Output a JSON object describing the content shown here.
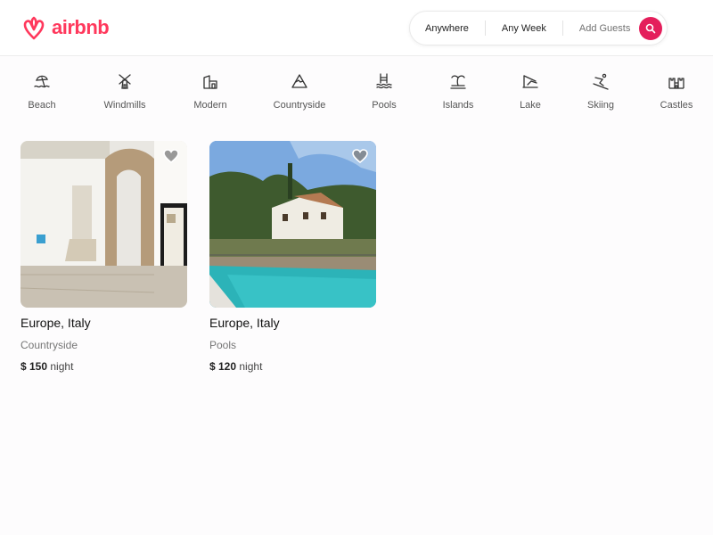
{
  "brand": {
    "name": "airbnb",
    "color": "#ff385c"
  },
  "search": {
    "where": "Anywhere",
    "when": "Any Week",
    "who": "Add Guests",
    "button_color": "#e41e5b"
  },
  "categories": [
    {
      "label": "Beach",
      "icon": "beach-icon"
    },
    {
      "label": "Windmills",
      "icon": "windmill-icon"
    },
    {
      "label": "Modern",
      "icon": "modern-house-icon"
    },
    {
      "label": "Countryside",
      "icon": "mountain-icon"
    },
    {
      "label": "Pools",
      "icon": "pool-icon"
    },
    {
      "label": "Islands",
      "icon": "island-icon"
    },
    {
      "label": "Lake",
      "icon": "lake-icon"
    },
    {
      "label": "Skiing",
      "icon": "skiing-icon"
    },
    {
      "label": "Castles",
      "icon": "castle-icon"
    }
  ],
  "listings": [
    {
      "location": "Europe, Italy",
      "category": "Countryside",
      "price": "$ 150",
      "unit": "night"
    },
    {
      "location": "Europe, Italy",
      "category": "Pools",
      "price": "$ 120",
      "unit": "night"
    }
  ]
}
